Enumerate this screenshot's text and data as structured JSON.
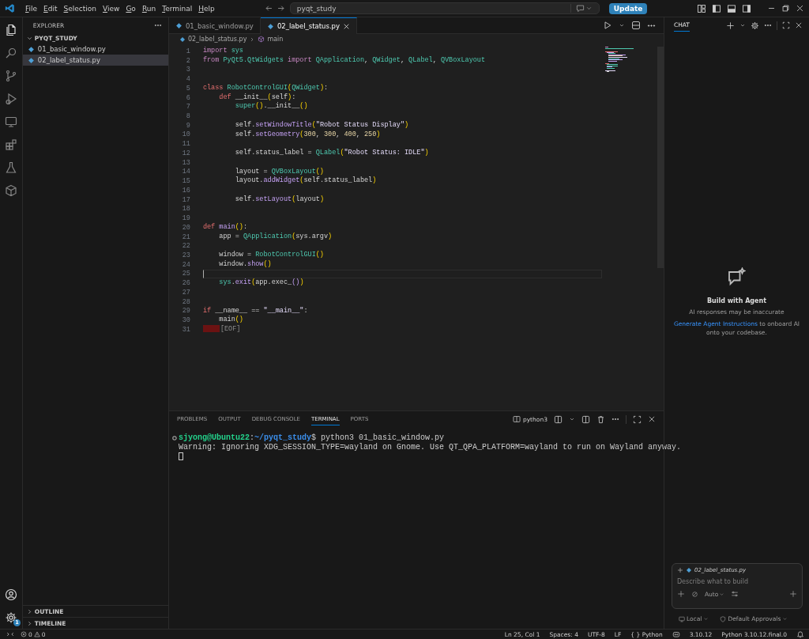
{
  "title_bar": {
    "menu": [
      "File",
      "Edit",
      "Selection",
      "View",
      "Go",
      "Run",
      "Terminal",
      "Help"
    ],
    "search": "pyqt_study",
    "update_button": "Update"
  },
  "activity_bar": {
    "settings_badge": "1"
  },
  "sidebar": {
    "title": "EXPLORER",
    "folder": "PYQT_STUDY",
    "files": [
      {
        "name": "01_basic_window.py",
        "selected": false
      },
      {
        "name": "02_label_status.py",
        "selected": true
      }
    ],
    "sections": [
      "OUTLINE",
      "TIMELINE"
    ]
  },
  "editor": {
    "tabs": [
      {
        "label": "01_basic_window.py",
        "selected": false
      },
      {
        "label": "02_label_status.py",
        "selected": true
      }
    ],
    "breadcrumb": [
      "02_label_status.py",
      "main"
    ],
    "lines": [
      {
        "n": "1",
        "tokens": [
          {
            "kind": "kw",
            "text": "import"
          },
          {
            "kind": "cls",
            "text": " sys"
          }
        ]
      },
      {
        "n": "2",
        "tokens": [
          {
            "kind": "kw",
            "text": "from"
          },
          {
            "kind": "cls",
            "text": " PyQt5.QtWidgets"
          },
          {
            "kind": "kw",
            "text": " import"
          },
          {
            "kind": "cls",
            "text": " QApplication"
          },
          {
            "kind": "p",
            "text": ", "
          },
          {
            "kind": "cls",
            "text": "QWidget"
          },
          {
            "kind": "p",
            "text": ", "
          },
          {
            "kind": "cls",
            "text": "QLabel"
          },
          {
            "kind": "p",
            "text": ", "
          },
          {
            "kind": "cls",
            "text": "QVBoxLayout"
          }
        ]
      },
      {
        "n": "3"
      },
      {
        "n": "4"
      },
      {
        "n": "5",
        "tokens": [
          {
            "kind": "decl",
            "text": "class"
          },
          {
            "kind": "cls",
            "text": " RobotControlGUI"
          },
          {
            "kind": "br",
            "text": "("
          },
          {
            "kind": "cls",
            "text": "QWidget"
          },
          {
            "kind": "br",
            "text": ")"
          },
          {
            "kind": "p",
            "text": ":"
          }
        ]
      },
      {
        "n": "6",
        "tokens": [
          {
            "kind": "decl",
            "text": "    def"
          },
          {
            "kind": "p",
            "text": " __init__"
          },
          {
            "kind": "br",
            "text": "("
          },
          {
            "kind": "var",
            "text": "self"
          },
          {
            "kind": "br",
            "text": ")"
          },
          {
            "kind": "p",
            "text": ":"
          }
        ]
      },
      {
        "n": "7",
        "tokens": [
          {
            "kind": "cls",
            "text": "        super"
          },
          {
            "kind": "br",
            "text": "()"
          },
          {
            "kind": "p",
            "text": ".__init__"
          },
          {
            "kind": "br",
            "text": "()"
          }
        ]
      },
      {
        "n": "8"
      },
      {
        "n": "9",
        "tokens": [
          {
            "kind": "var",
            "text": "        self"
          },
          {
            "kind": "p",
            "text": "."
          },
          {
            "kind": "fn",
            "text": "setWindowTitle"
          },
          {
            "kind": "br",
            "text": "("
          },
          {
            "kind": "str",
            "text": "\"Robot Status Display\""
          },
          {
            "kind": "br",
            "text": ")"
          }
        ]
      },
      {
        "n": "10",
        "tokens": [
          {
            "kind": "var",
            "text": "        self"
          },
          {
            "kind": "p",
            "text": "."
          },
          {
            "kind": "fn",
            "text": "setGeometry"
          },
          {
            "kind": "br",
            "text": "("
          },
          {
            "kind": "num",
            "text": "300"
          },
          {
            "kind": "p",
            "text": ", "
          },
          {
            "kind": "num",
            "text": "300"
          },
          {
            "kind": "p",
            "text": ", "
          },
          {
            "kind": "num",
            "text": "400"
          },
          {
            "kind": "p",
            "text": ", "
          },
          {
            "kind": "num",
            "text": "250"
          },
          {
            "kind": "br",
            "text": ")"
          }
        ]
      },
      {
        "n": "11"
      },
      {
        "n": "12",
        "tokens": [
          {
            "kind": "var",
            "text": "        self"
          },
          {
            "kind": "p",
            "text": ".status_label = "
          },
          {
            "kind": "cls",
            "text": "QLabel"
          },
          {
            "kind": "br",
            "text": "("
          },
          {
            "kind": "str",
            "text": "\"Robot Status: IDLE\""
          },
          {
            "kind": "br",
            "text": ")"
          }
        ]
      },
      {
        "n": "13"
      },
      {
        "n": "14",
        "tokens": [
          {
            "kind": "p",
            "text": "        layout = "
          },
          {
            "kind": "cls",
            "text": "QVBoxLayout"
          },
          {
            "kind": "br",
            "text": "()"
          }
        ]
      },
      {
        "n": "15",
        "tokens": [
          {
            "kind": "p",
            "text": "        layout."
          },
          {
            "kind": "fn",
            "text": "addWidget"
          },
          {
            "kind": "br",
            "text": "("
          },
          {
            "kind": "var",
            "text": "self"
          },
          {
            "kind": "p",
            "text": ".status_label"
          },
          {
            "kind": "br",
            "text": ")"
          }
        ]
      },
      {
        "n": "16"
      },
      {
        "n": "17",
        "tokens": [
          {
            "kind": "var",
            "text": "        self"
          },
          {
            "kind": "p",
            "text": "."
          },
          {
            "kind": "fn",
            "text": "setLayout"
          },
          {
            "kind": "br",
            "text": "("
          },
          {
            "kind": "p",
            "text": "layout"
          },
          {
            "kind": "br",
            "text": ")"
          }
        ]
      },
      {
        "n": "18"
      },
      {
        "n": "19"
      },
      {
        "n": "20",
        "tokens": [
          {
            "kind": "decl",
            "text": "def"
          },
          {
            "kind": "fn",
            "text": " main"
          },
          {
            "kind": "br",
            "text": "()"
          },
          {
            "kind": "p",
            "text": ":"
          }
        ]
      },
      {
        "n": "21",
        "tokens": [
          {
            "kind": "p",
            "text": "    app = "
          },
          {
            "kind": "cls",
            "text": "QApplication"
          },
          {
            "kind": "br",
            "text": "("
          },
          {
            "kind": "p",
            "text": "sys.argv"
          },
          {
            "kind": "br",
            "text": ")"
          }
        ]
      },
      {
        "n": "22"
      },
      {
        "n": "23",
        "tokens": [
          {
            "kind": "p",
            "text": "    window = "
          },
          {
            "kind": "cls",
            "text": "RobotControlGUI"
          },
          {
            "kind": "br",
            "text": "()"
          }
        ]
      },
      {
        "n": "24",
        "tokens": [
          {
            "kind": "p",
            "text": "    window."
          },
          {
            "kind": "fn",
            "text": "show"
          },
          {
            "kind": "br",
            "text": "()"
          }
        ]
      },
      {
        "n": "25",
        "current": true
      },
      {
        "n": "26",
        "tokens": [
          {
            "kind": "cls",
            "text": "    sys"
          },
          {
            "kind": "p",
            "text": "."
          },
          {
            "kind": "fn",
            "text": "exit"
          },
          {
            "kind": "br",
            "text": "("
          },
          {
            "kind": "p",
            "text": "app.exec_"
          },
          {
            "kind": "fn",
            "text": "()"
          },
          {
            "kind": "br",
            "text": ")"
          }
        ]
      },
      {
        "n": "27"
      },
      {
        "n": "28"
      },
      {
        "n": "29",
        "tokens": [
          {
            "kind": "decl",
            "text": "if"
          },
          {
            "kind": "p",
            "text": " __name__ == "
          },
          {
            "kind": "str",
            "text": "\"__main__\""
          },
          {
            "kind": "p",
            "text": ":"
          }
        ]
      },
      {
        "n": "30",
        "tokens": [
          {
            "kind": "p",
            "text": "    main"
          },
          {
            "kind": "br",
            "text": "()"
          }
        ]
      },
      {
        "n": "31",
        "tokens": [
          {
            "kind": "eof",
            "text": "[EOF]"
          }
        ]
      }
    ]
  },
  "panel": {
    "tabs": [
      {
        "label": "PROBLEMS",
        "selected": false
      },
      {
        "label": "OUTPUT",
        "selected": false
      },
      {
        "label": "DEBUG CONSOLE",
        "selected": false
      },
      {
        "label": "TERMINAL",
        "selected": true
      },
      {
        "label": "PORTS",
        "selected": false
      }
    ],
    "terminal_name": "python3",
    "prompt": {
      "user": "sjyong@Ubuntu22",
      "separator": ":",
      "path": "~/pyqt_study",
      "command": "$ python3 01_basic_window.py"
    },
    "output": [
      "Warning: Ignoring XDG_SESSION_TYPE=wayland on Gnome. Use QT_QPA_PLATFORM=wayland to run on Wayland anyway."
    ]
  },
  "chat": {
    "tab": "CHAT",
    "heading": "Build with Agent",
    "note": "AI responses may be inaccurate",
    "link": "Generate Agent Instructions",
    "link_rest": " to onboard AI onto your codebase.",
    "context_file": "02_label_status.py",
    "placeholder": "Describe what to build",
    "mode": "Auto",
    "location": "Local",
    "approvals": "Default Approvals"
  },
  "status_bar": {
    "errors": "0",
    "warnings": "0",
    "position": "Ln 25, Col 1",
    "indent": "Spaces: 4",
    "encoding": "UTF-8",
    "eol": "LF",
    "language_icon": "{ }",
    "language": "Python",
    "version": "3.10.12",
    "interpreter": "Python 3.10.12.final.0"
  }
}
